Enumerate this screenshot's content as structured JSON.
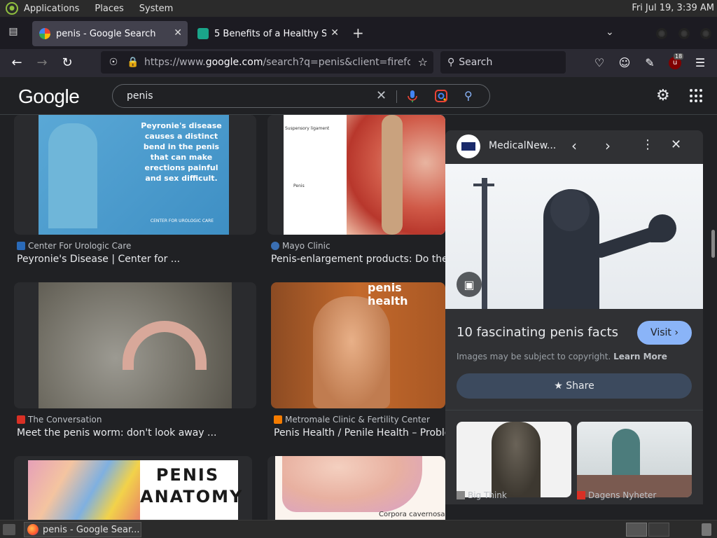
{
  "system_panel": {
    "menus": [
      "Applications",
      "Places",
      "System"
    ],
    "clock": "Fri Jul 19,  3:39 AM"
  },
  "browser": {
    "tabs": [
      {
        "title": "penis - Google Search",
        "active": true
      },
      {
        "title": "5 Benefits of a Healthy Sex L",
        "active": false
      }
    ],
    "url_prefix": "https://www.",
    "url_domain": "google.com",
    "url_rest": "/search?q=penis&client=firefox-b-1",
    "search_placeholder": "Search",
    "ublock_count": "18"
  },
  "google": {
    "logo": "Google",
    "query": "penis"
  },
  "results": [
    {
      "source": "Center For Urologic Care",
      "title": "Peyronie's Disease | Center for ...",
      "thumb_text": "Peyronie's disease causes a distinct bend in the penis that can make erections painful and sex difficult.",
      "thumb_footer": "CENTER FOR UROLOGIC CARE"
    },
    {
      "source": "Mayo Clinic",
      "title": "Penis-enlargement products: Do they ...",
      "thumb_labels": [
        "Suspensory ligament",
        "Penis"
      ]
    },
    {
      "source": "The Conversation",
      "title": "Meet the penis worm: don't look away ..."
    },
    {
      "source": "Metromale Clinic & Fertility Center",
      "title": "Penis Health / Penile Health – Proble...",
      "thumb_text": "penis health"
    },
    {
      "thumb_text": "PENIS ANATOMY"
    },
    {
      "thumb_labels": [
        "Corpora cavernosa"
      ]
    }
  ],
  "panel": {
    "source": "MedicalNew...",
    "title": "10 fascinating penis facts",
    "visit_label": "Visit",
    "copyright_text": "Images may be subject to copyright.",
    "learn_more": "Learn More",
    "share_label": "Share",
    "related": [
      {
        "source": "Big Think"
      },
      {
        "source": "Dagens Nyheter"
      }
    ]
  },
  "taskbar": {
    "task_label": "penis - Google Sear..."
  }
}
